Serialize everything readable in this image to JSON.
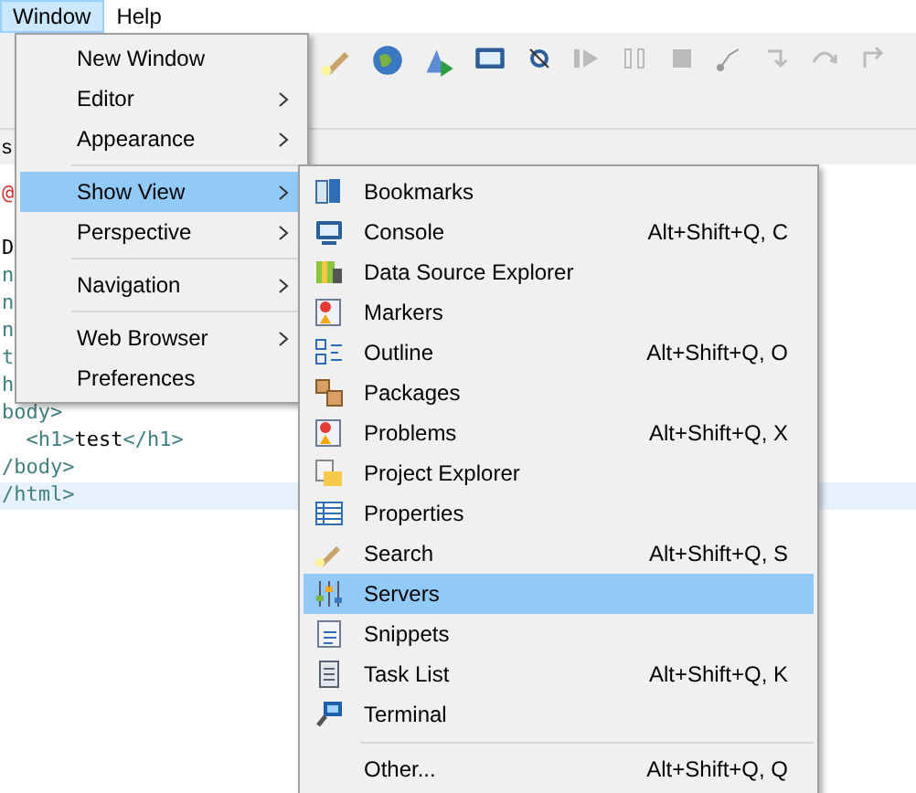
{
  "menubar": [
    {
      "label": "Window",
      "selected": true
    },
    {
      "label": "Help",
      "selected": false
    }
  ],
  "editor": {
    "tab_fragment": "s",
    "lines": [
      {
        "tokens": [
          {
            "kind": "marker",
            "text": "@"
          }
        ],
        "current": false
      },
      {
        "current": false
      },
      {
        "tokens": [
          {
            "kind": "text",
            "text": "D"
          }
        ],
        "current": false
      },
      {
        "tokens": [
          {
            "kind": "tag",
            "text": "n"
          }
        ],
        "current": false
      },
      {
        "tokens": [
          {
            "kind": "tag",
            "text": "n"
          }
        ],
        "current": false
      },
      {
        "tokens": [
          {
            "kind": "tag",
            "text": "n"
          }
        ],
        "current": false
      },
      {
        "tokens": [
          {
            "kind": "tag",
            "text": "t"
          }
        ],
        "current": false
      },
      {
        "tokens": [
          {
            "kind": "tag",
            "text": "h"
          }
        ],
        "current": false
      },
      {
        "tokens": [
          {
            "kind": "tag",
            "text": "body>"
          }
        ],
        "current": false
      },
      {
        "tokens": [
          {
            "kind": "tag",
            "text": "  <h1>"
          },
          {
            "kind": "text",
            "text": "test"
          },
          {
            "kind": "tag",
            "text": "</h1>"
          }
        ],
        "current": false
      },
      {
        "tokens": [
          {
            "kind": "tag",
            "text": "/body>"
          }
        ],
        "current": false
      },
      {
        "tokens": [
          {
            "kind": "tag",
            "text": "/html>"
          }
        ],
        "current": true
      }
    ]
  },
  "window_menu": [
    {
      "kind": "item",
      "label": "New Window",
      "submenu": false,
      "selected": false
    },
    {
      "kind": "item",
      "label": "Editor",
      "submenu": true,
      "selected": false
    },
    {
      "kind": "item",
      "label": "Appearance",
      "submenu": true,
      "selected": false
    },
    {
      "kind": "separator"
    },
    {
      "kind": "item",
      "label": "Show View",
      "submenu": true,
      "selected": true
    },
    {
      "kind": "item",
      "label": "Perspective",
      "submenu": true,
      "selected": false
    },
    {
      "kind": "separator"
    },
    {
      "kind": "item",
      "label": "Navigation",
      "submenu": true,
      "selected": false
    },
    {
      "kind": "separator"
    },
    {
      "kind": "item",
      "label": "Web Browser",
      "submenu": true,
      "selected": false
    },
    {
      "kind": "item",
      "label": "Preferences",
      "submenu": false,
      "selected": false
    }
  ],
  "show_view_menu": [
    {
      "kind": "item",
      "label": "Bookmarks",
      "selected": false
    },
    {
      "kind": "item",
      "label": "Console",
      "shortcut": "Alt+Shift+Q, C",
      "selected": false
    },
    {
      "kind": "item",
      "label": "Data Source Explorer",
      "selected": false
    },
    {
      "kind": "item",
      "label": "Markers",
      "selected": false
    },
    {
      "kind": "item",
      "label": "Outline",
      "shortcut": "Alt+Shift+Q, O",
      "selected": false
    },
    {
      "kind": "item",
      "label": "Packages",
      "selected": false
    },
    {
      "kind": "item",
      "label": "Problems",
      "shortcut": "Alt+Shift+Q, X",
      "selected": false
    },
    {
      "kind": "item",
      "label": "Project Explorer",
      "selected": false
    },
    {
      "kind": "item",
      "label": "Properties",
      "selected": false
    },
    {
      "kind": "item",
      "label": "Search",
      "shortcut": "Alt+Shift+Q, S",
      "selected": false
    },
    {
      "kind": "item",
      "label": "Servers",
      "selected": true
    },
    {
      "kind": "item",
      "label": "Snippets",
      "selected": false
    },
    {
      "kind": "item",
      "label": "Task List",
      "shortcut": "Alt+Shift+Q, K",
      "selected": false
    },
    {
      "kind": "item",
      "label": "Terminal",
      "selected": false
    },
    {
      "kind": "separator"
    },
    {
      "kind": "item",
      "label": "Other...",
      "shortcut": "Alt+Shift+Q, Q",
      "selected": false
    }
  ]
}
